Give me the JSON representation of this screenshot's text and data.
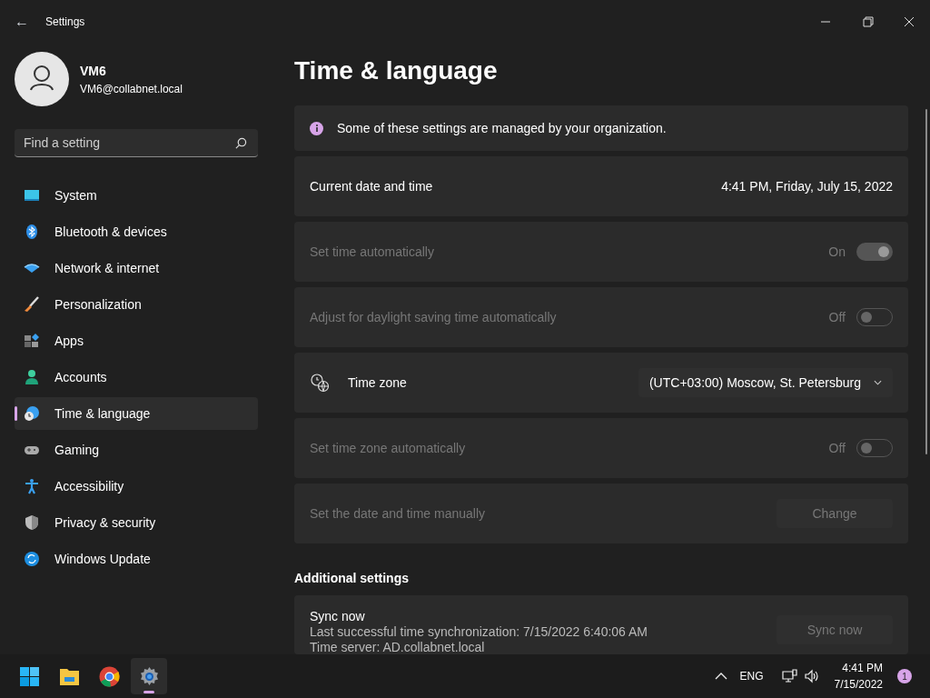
{
  "window": {
    "title": "Settings",
    "back": "←"
  },
  "profile": {
    "name": "VM6",
    "email": "VM6@collabnet.local"
  },
  "search": {
    "placeholder": "Find a setting"
  },
  "sidebar": {
    "items": [
      {
        "label": "System",
        "selected": false
      },
      {
        "label": "Bluetooth & devices",
        "selected": false
      },
      {
        "label": "Network & internet",
        "selected": false
      },
      {
        "label": "Personalization",
        "selected": false
      },
      {
        "label": "Apps",
        "selected": false
      },
      {
        "label": "Accounts",
        "selected": false
      },
      {
        "label": "Time & language",
        "selected": true
      },
      {
        "label": "Gaming",
        "selected": false
      },
      {
        "label": "Accessibility",
        "selected": false
      },
      {
        "label": "Privacy & security",
        "selected": false
      },
      {
        "label": "Windows Update",
        "selected": false
      }
    ]
  },
  "page": {
    "title": "Time & language",
    "rows": [
      {
        "kind": "info",
        "label": "Some of these settings are managed by your organization."
      },
      {
        "kind": "value",
        "label": "Current date and time",
        "value": "4:41 PM, Friday, July 15, 2022",
        "disabled": false
      },
      {
        "kind": "toggle",
        "label": "Set time automatically",
        "state": "On",
        "on": true,
        "disabled": true
      },
      {
        "kind": "toggle",
        "label": "Adjust for daylight saving time automatically",
        "state": "Off",
        "on": false,
        "disabled": true
      },
      {
        "kind": "dropdown",
        "label": "Time zone",
        "value": "(UTC+03:00) Moscow, St. Petersburg",
        "disabled": false
      },
      {
        "kind": "toggle",
        "label": "Set time zone automatically",
        "state": "Off",
        "on": false,
        "disabled": true
      },
      {
        "kind": "button",
        "label": "Set the date and time manually",
        "button": "Change",
        "disabled": true
      }
    ],
    "section": "Additional settings",
    "sync": {
      "title": "Sync now",
      "lines": [
        "Last successful time synchronization: 7/15/2022 6:40:06 AM",
        "Time server: AD.collabnet.local"
      ],
      "button": "Sync now",
      "disabled": true
    }
  },
  "taskbar": {
    "apps": [
      {
        "selected": false
      },
      {
        "selected": false
      },
      {
        "selected": false
      },
      {
        "selected": true
      }
    ],
    "tray": {
      "language": "ENG",
      "time": "4:41 PM",
      "date": "7/15/2022",
      "notifications": "1"
    }
  }
}
